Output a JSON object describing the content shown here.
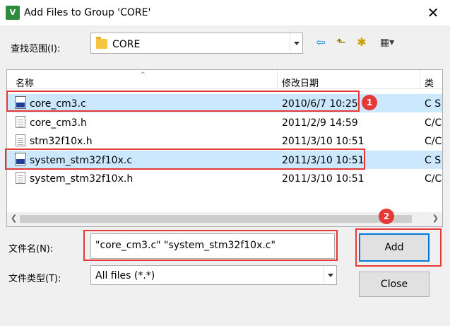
{
  "window": {
    "title": "Add Files to Group 'CORE'",
    "app_icon_text": "V",
    "close_symbol": "✕"
  },
  "look_in": {
    "label": "查找范围(I):",
    "value": "CORE"
  },
  "toolbar": {
    "back_icon": "⇦",
    "up_icon": "⬑",
    "new_folder_icon": "✱",
    "view_menu_icon": "▦▾"
  },
  "file_list": {
    "columns": [
      "名称",
      "修改日期",
      "类"
    ],
    "rows": [
      {
        "name": "core_cm3.c",
        "date": "2010/6/7 10:25",
        "type": "C S",
        "selected": true,
        "icon": "c-source-icon"
      },
      {
        "name": "core_cm3.h",
        "date": "2011/2/9 14:59",
        "type": "C/C",
        "selected": false,
        "icon": "header-file-icon"
      },
      {
        "name": "stm32f10x.h",
        "date": "2011/3/10 10:51",
        "type": "C/C",
        "selected": false,
        "icon": "header-file-icon"
      },
      {
        "name": "system_stm32f10x.c",
        "date": "2011/3/10 10:51",
        "type": "C S",
        "selected": true,
        "icon": "c-source-icon"
      },
      {
        "name": "system_stm32f10x.h",
        "date": "2011/3/10 10:51",
        "type": "C/C",
        "selected": false,
        "icon": "header-file-icon"
      }
    ]
  },
  "filename": {
    "label": "文件名(N):",
    "value": "\"core_cm3.c\" \"system_stm32f10x.c\""
  },
  "filetype": {
    "label": "文件类型(T):",
    "value": "All files (*.*)"
  },
  "buttons": {
    "add": "Add",
    "close": "Close"
  },
  "annotations": {
    "badge1": "1",
    "badge2": "2",
    "color": "#e53935"
  },
  "colors": {
    "selection": "#cce8ff",
    "dialog_bg": "#f0f0f0"
  }
}
